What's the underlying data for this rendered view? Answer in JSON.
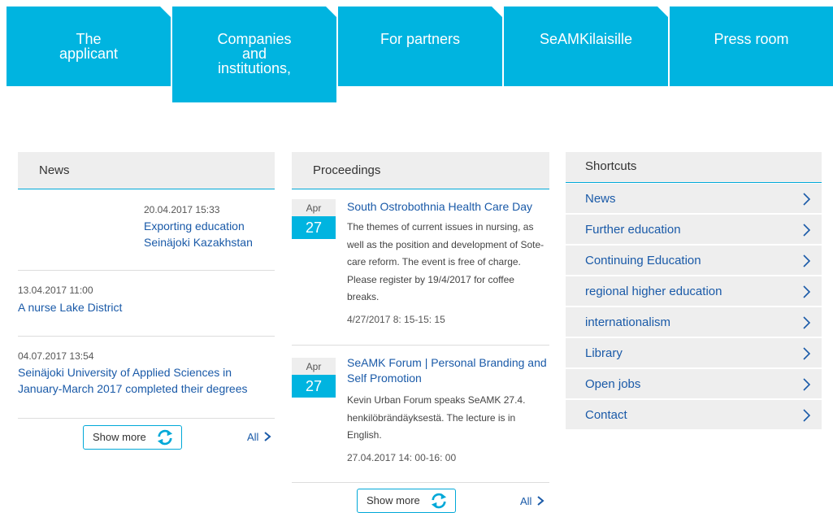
{
  "nav": {
    "tabs": [
      {
        "label": "The\napplicant"
      },
      {
        "label": "Companies\nand\ninstitutions,"
      },
      {
        "label": "For partners"
      },
      {
        "label": "SeAMKilaisille"
      },
      {
        "label": "Press room"
      }
    ]
  },
  "news": {
    "header": "News",
    "items": [
      {
        "date": "20.04.2017 15:33",
        "title": "Exporting education Seinäjoki Kazakhstan"
      },
      {
        "date": "13.04.2017 11:00",
        "title": "A nurse Lake District"
      },
      {
        "date": "04.07.2017 13:54",
        "title": "Seinäjoki University of Applied Sciences in January-March 2017 completed their degrees"
      }
    ],
    "show_more": "Show more",
    "all": "All"
  },
  "proceedings": {
    "header": "Proceedings",
    "events": [
      {
        "month": "Apr",
        "day": "27",
        "title": "South Ostrobothnia Health Care Day",
        "description": "The themes of current issues in nursing, as well as the position and development of Sote-care reform. The event is free of charge. Please register by 19/4/2017 for coffee breaks.",
        "time": "4/27/2017 8: 15-15: 15"
      },
      {
        "month": "Apr",
        "day": "27",
        "title": "SeAMK Forum | Personal Branding and Self Promotion",
        "description": "Kevin Urban Forum speaks SeAMK 27.4. henkilöbrändäyksestä. The lecture is in English.",
        "time": "27.04.2017 14: 00-16: 00"
      }
    ],
    "show_more": "Show more",
    "all": "All"
  },
  "shortcuts": {
    "header": "Shortcuts",
    "items": [
      {
        "label": "News"
      },
      {
        "label": "Further education"
      },
      {
        "label": "Continuing Education"
      },
      {
        "label": "regional higher education"
      },
      {
        "label": "internationalism"
      },
      {
        "label": "Library"
      },
      {
        "label": "Open jobs"
      },
      {
        "label": "Contact"
      }
    ]
  },
  "colors": {
    "accent": "#00b4e0",
    "link": "#1a5aa8",
    "panel": "#eeeeee"
  },
  "icons": [
    "refresh-icon",
    "chevron-right-icon"
  ]
}
